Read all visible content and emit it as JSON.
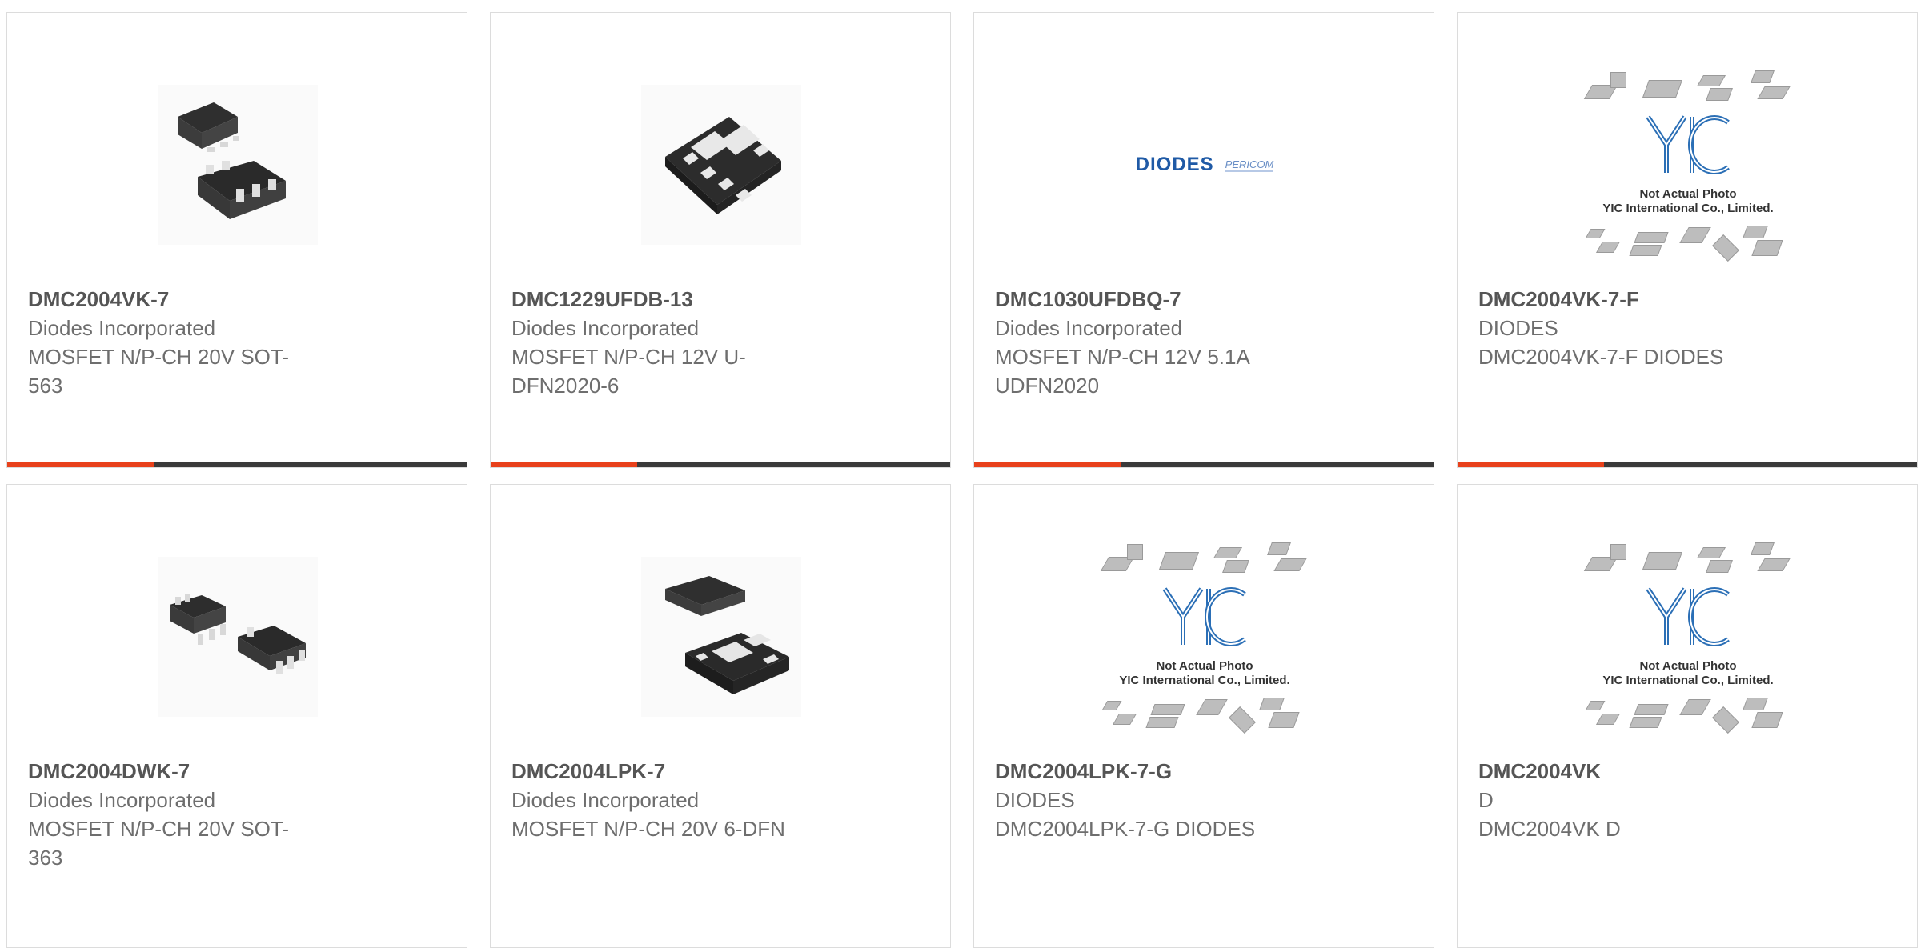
{
  "colors": {
    "accent": "#e8411b",
    "bar_dark": "#3a3a3a"
  },
  "placeholder": {
    "line1": "Not Actual Photo",
    "line2": "YIC International Co., Limited.",
    "logo_text": "YIC"
  },
  "logo": {
    "brand1": "DIODES",
    "brand2": "PERICOM"
  },
  "cards": [
    {
      "part": "DMC2004VK-7",
      "manufacturer": "Diodes Incorporated",
      "desc": "MOSFET N/P-CH 20V SOT-563",
      "image": "sot563-package-image"
    },
    {
      "part": "DMC1229UFDB-13",
      "manufacturer": "Diodes Incorporated",
      "desc": "MOSFET N/P-CH 12V U-DFN2020-6",
      "image": "udfn-package-image"
    },
    {
      "part": "DMC1030UFDBQ-7",
      "manufacturer": "Diodes Incorporated",
      "desc": "MOSFET N/P-CH 12V 5.1A UDFN2020",
      "image": "diodes-pericom-logo"
    },
    {
      "part": "DMC2004VK-7-F",
      "manufacturer": "DIODES",
      "desc": "DMC2004VK-7-F DIODES",
      "image": "not-actual-photo"
    },
    {
      "part": "DMC2004DWK-7",
      "manufacturer": "Diodes Incorporated",
      "desc": "MOSFET N/P-CH 20V SOT-363",
      "image": "sot363-package-image"
    },
    {
      "part": "DMC2004LPK-7",
      "manufacturer": "Diodes Incorporated",
      "desc": "MOSFET N/P-CH 20V 6-DFN",
      "image": "dfn-package-image"
    },
    {
      "part": "DMC2004LPK-7-G",
      "manufacturer": "DIODES",
      "desc": "DMC2004LPK-7-G DIODES",
      "image": "not-actual-photo"
    },
    {
      "part": "DMC2004VK",
      "manufacturer": "D",
      "desc": "DMC2004VK D",
      "image": "not-actual-photo"
    }
  ]
}
